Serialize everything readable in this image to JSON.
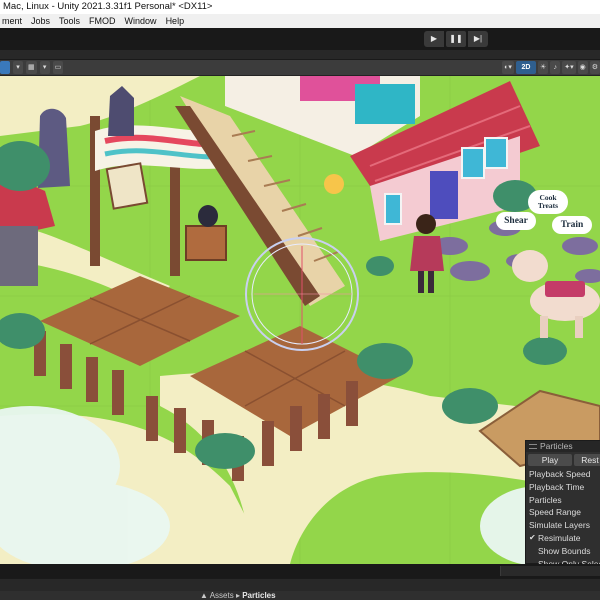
{
  "window": {
    "title": "Mac, Linux - Unity 2021.3.31f1 Personal* <DX11>"
  },
  "menu": {
    "items": [
      "ment",
      "Jobs",
      "Tools",
      "FMOD",
      "Window",
      "Help"
    ]
  },
  "playbar": {
    "play_icon": "play-icon",
    "pause_icon": "pause-icon",
    "step_icon": "step-icon",
    "play_glyph": "▶",
    "pause_glyph": "❚❚",
    "step_glyph": "▶|"
  },
  "scene_toolbar": {
    "mode_2d": "2D"
  },
  "scene_labels": {
    "cook_treats_line1": "Cook",
    "cook_treats_line2": "Treats",
    "shear": "Shear",
    "train": "Train"
  },
  "particles": {
    "title": "Particles",
    "play_button": "Play",
    "restart_button": "Rest",
    "rows": [
      "Playback Speed",
      "Playback Time",
      "Particles",
      "Speed Range",
      "Simulate Layers"
    ],
    "resimulate": "Resimulate",
    "show_bounds": "Show Bounds",
    "show_only_selected": "Show Only Select",
    "checkmark": "✔"
  },
  "project": {
    "breadcrumb_root": "Assets",
    "breadcrumb_current": "Particles",
    "breadcrumb_arrow": "▲"
  },
  "colors": {
    "grass": "#93d64a",
    "path": "#f3eec4",
    "roof": "#c93a4d",
    "wall": "#f4cbd2",
    "soil": "#a8673c"
  }
}
